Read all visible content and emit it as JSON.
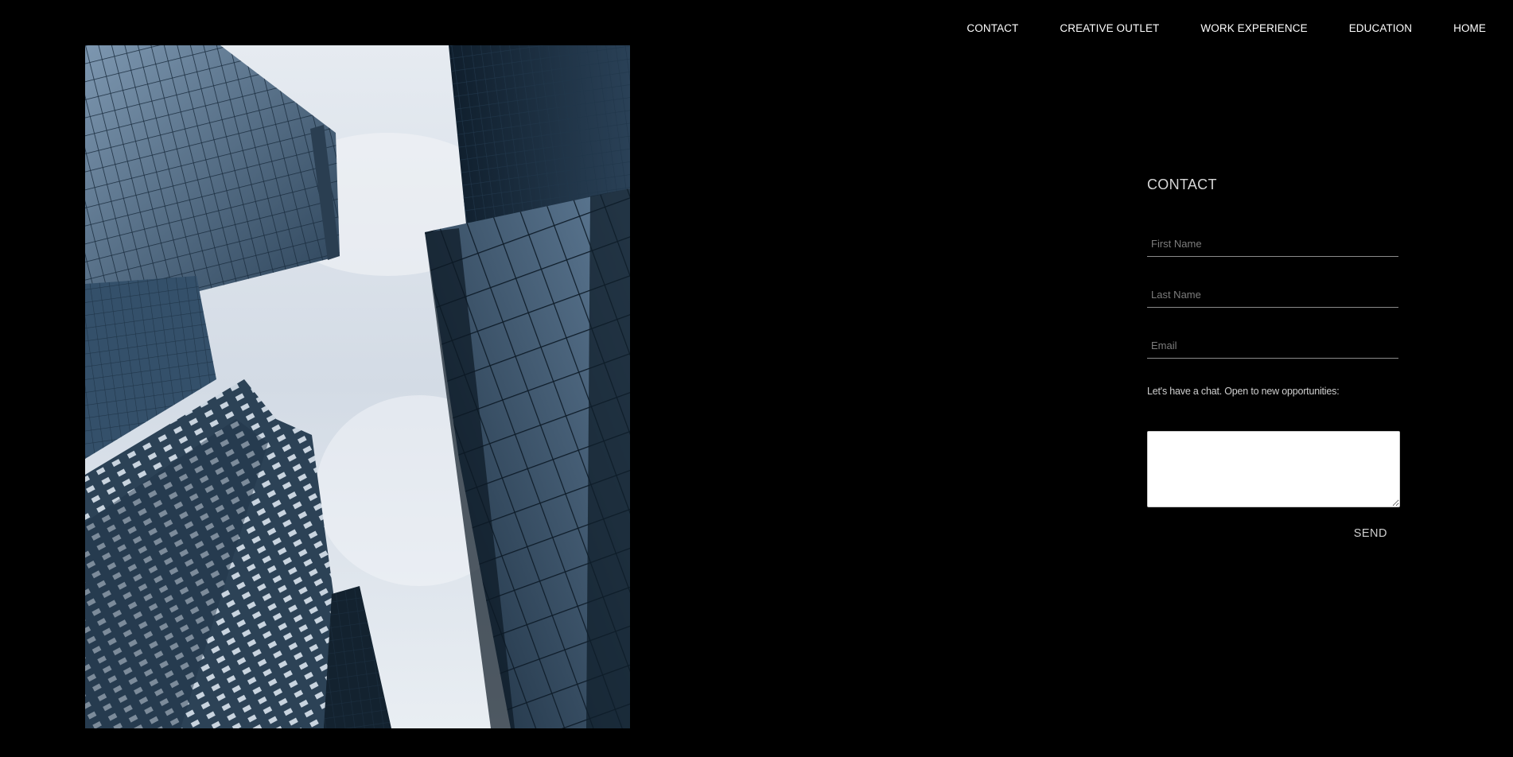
{
  "nav": {
    "items": [
      {
        "label": "CONTACT"
      },
      {
        "label": "CREATIVE OUTLET"
      },
      {
        "label": "WORK EXPERIENCE"
      },
      {
        "label": "EDUCATION"
      },
      {
        "label": "HOME"
      }
    ]
  },
  "hero_image": {
    "subject": "skyscrapers-looking-up"
  },
  "contact": {
    "title": "CONTACT",
    "first_name_placeholder": "First Name",
    "first_name_value": "",
    "last_name_placeholder": "Last Name",
    "last_name_value": "",
    "email_placeholder": "Email",
    "email_value": "",
    "message_prompt": "Let's have a chat. Open to new opportunities:",
    "message_value": "",
    "send_label": "SEND"
  },
  "colors": {
    "background": "#000000",
    "text": "#ffffff",
    "muted": "#cfcfcf"
  }
}
